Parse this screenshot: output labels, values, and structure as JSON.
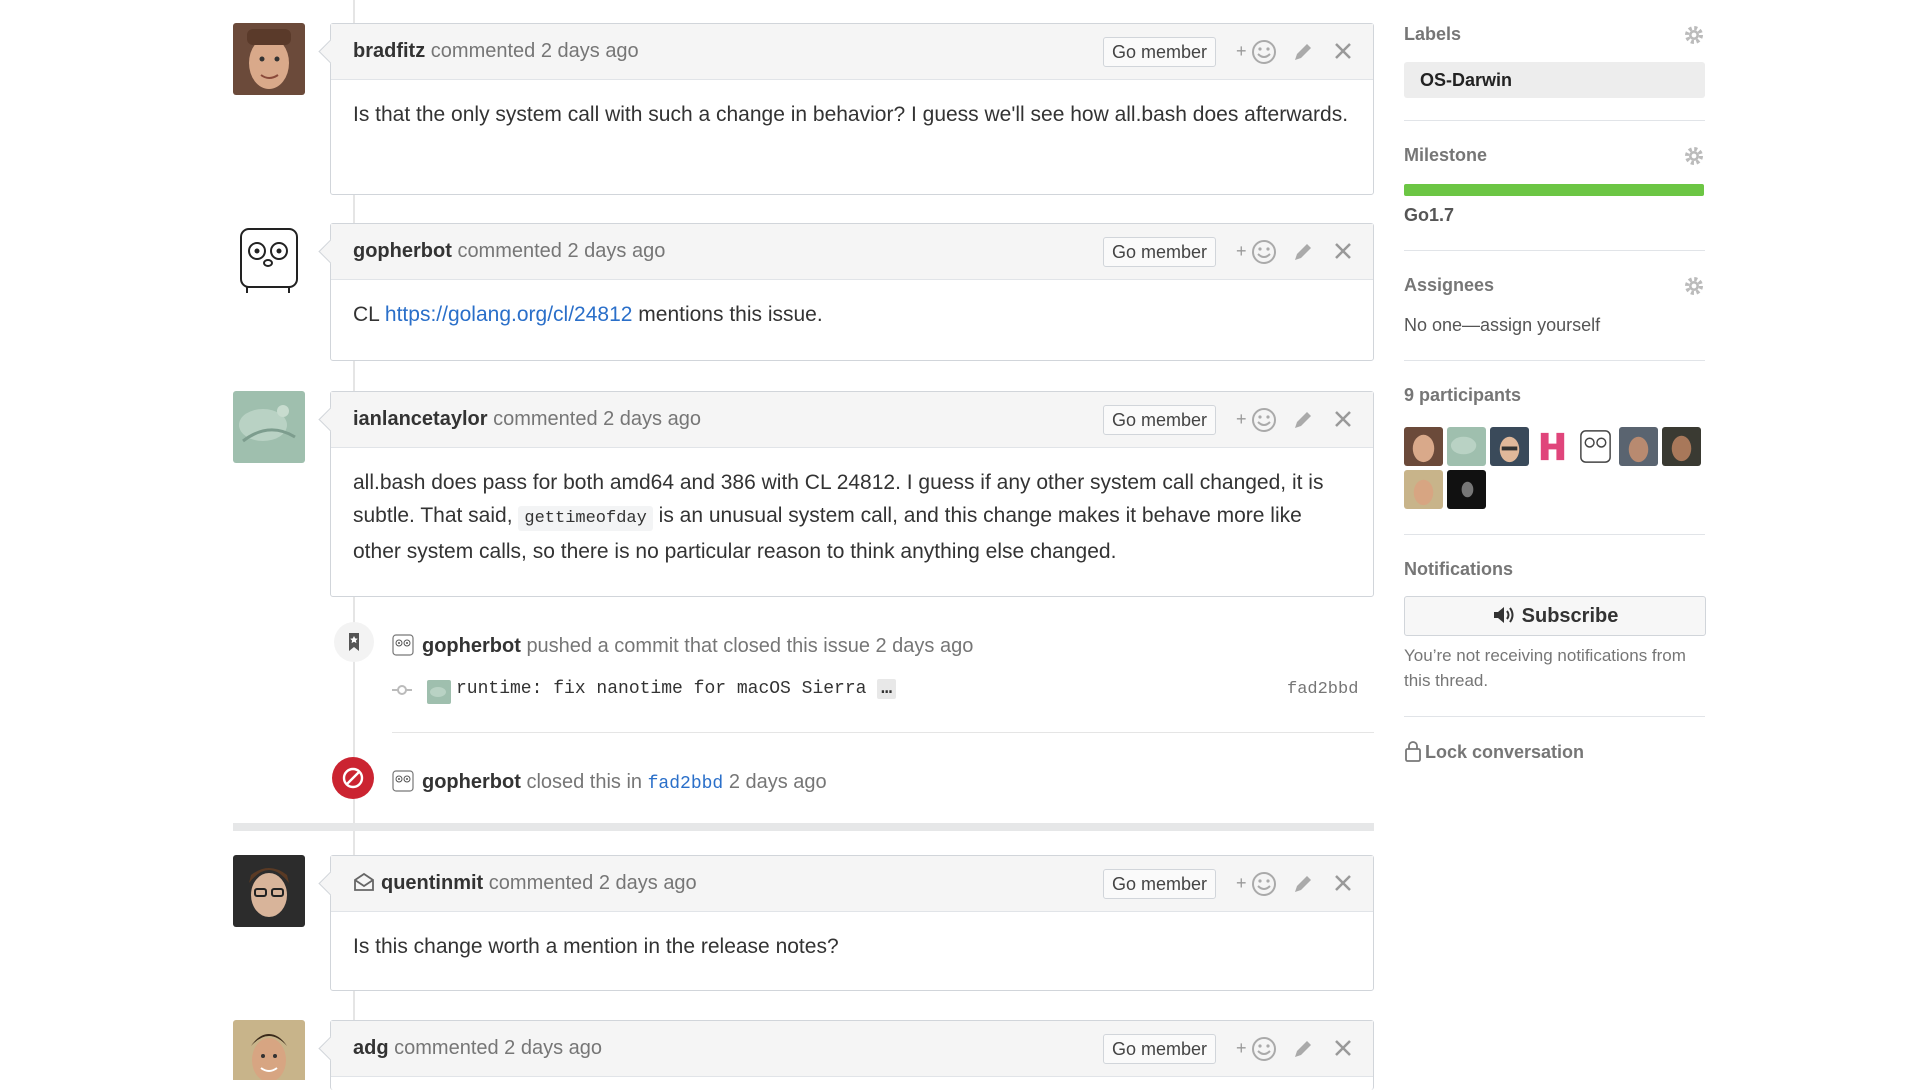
{
  "comments": [
    {
      "author": "bradfitz",
      "action": "commented 2 days ago",
      "role": "Go member",
      "body": "Is that the only system call with such a change in behavior? I guess we'll see how all.bash does afterwards."
    },
    {
      "author": "gopherbot",
      "action": "commented 2 days ago",
      "role": "Go member",
      "body_prefix": "CL",
      "body_link": "https://golang.org/cl/24812",
      "body_suffix": "mentions this issue."
    },
    {
      "author": "ianlancetaylor",
      "action": "commented 2 days ago",
      "role": "Go member",
      "body_part1": "all.bash does pass for both amd64 and 386 with CL 24812. I guess if any other system call changed, it is subtle. That said,",
      "body_code": "gettimeofday",
      "body_part2": "is an unusual system call, and this change makes it behave more like other system calls, so there is no particular reason to think anything else changed."
    },
    {
      "author": "quentinmit",
      "action": "commented 2 days ago",
      "role": "Go member",
      "body": "Is this change worth a mention in the release notes?"
    },
    {
      "author": "adg",
      "action": "commented 2 days ago",
      "role": "Go member"
    }
  ],
  "events": {
    "push": {
      "author": "gopherbot",
      "text": "pushed a commit that closed this issue 2 days ago",
      "commit_message": "runtime: fix nanotime for macOS Sierra",
      "ellipsis": "…",
      "commit_hash": "fad2bbd"
    },
    "close": {
      "author": "gopherbot",
      "text_prefix": "closed this in",
      "commit_hash": "fad2bbd",
      "text_suffix": "2 days ago"
    }
  },
  "reactions": {
    "plus": "+"
  },
  "sidebar": {
    "labels": {
      "title": "Labels",
      "items": [
        "OS-Darwin"
      ]
    },
    "milestone": {
      "title": "Milestone",
      "name": "Go1.7",
      "progress": 1.0
    },
    "assignees": {
      "title": "Assignees",
      "value": "No one—assign yourself"
    },
    "participants": {
      "title": "9 participants"
    },
    "notifications": {
      "title": "Notifications",
      "button": "Subscribe",
      "note": "You’re not receiving notifications from this thread."
    },
    "lock": "Lock conversation"
  },
  "colors": {
    "milestone_bar": "#6cc644",
    "closed_badge": "#cb2431",
    "link": "#2a6fc9"
  }
}
